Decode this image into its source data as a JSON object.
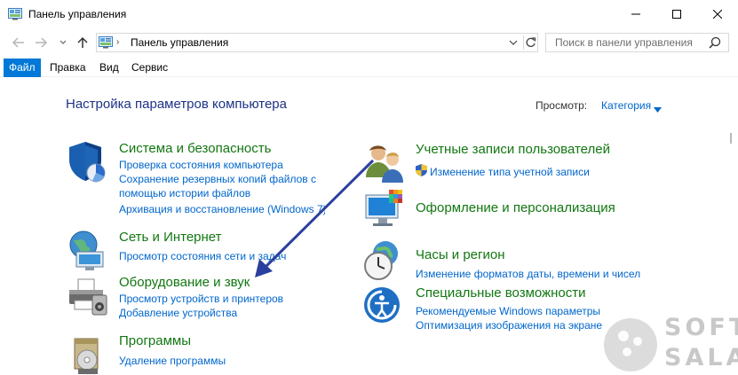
{
  "window": {
    "title": "Панель управления"
  },
  "address": {
    "path": "Панель управления",
    "separator": "›"
  },
  "search": {
    "placeholder": "Поиск в панели управления"
  },
  "menu": [
    {
      "label": "Файл",
      "active": true
    },
    {
      "label": "Правка",
      "active": false
    },
    {
      "label": "Вид",
      "active": false
    },
    {
      "label": "Сервис",
      "active": false
    }
  ],
  "main": {
    "title": "Настройка параметров компьютера",
    "view_by_label": "Просмотр:",
    "view_by_value": "Категория"
  },
  "categories_left": [
    {
      "title": "Система и безопасность",
      "icon": "shield-icon",
      "links": [
        "Проверка состояния компьютера",
        "Сохранение резервных копий файлов с",
        "помощью истории файлов",
        "Архивация и восстановление (Windows 7)"
      ]
    },
    {
      "title": "Сеть и Интернет",
      "icon": "network-icon",
      "links": [
        "Просмотр состояния сети и задач"
      ]
    },
    {
      "title": "Оборудование и звук",
      "icon": "printer-icon",
      "links": [
        "Просмотр устройств и принтеров",
        "Добавление устройства"
      ]
    },
    {
      "title": "Программы",
      "icon": "programs-icon",
      "links": [
        "Удаление программы"
      ]
    }
  ],
  "categories_right": [
    {
      "title": "Учетные записи пользователей",
      "icon": "users-icon",
      "links": [
        "Изменение типа учетной записи"
      ]
    },
    {
      "title": "Оформление и персонализация",
      "icon": "monitor-icon",
      "links": []
    },
    {
      "title": "Часы и регион",
      "icon": "clock-globe-icon",
      "links": [
        "Изменение форматов даты, времени и чисел"
      ]
    },
    {
      "title": "Специальные возможности",
      "icon": "accessibility-icon",
      "links": [
        "Рекомендуемые Windows параметры",
        "Оптимизация изображения на экране"
      ]
    }
  ],
  "watermark": {
    "line1": "SOFT",
    "line2": "SALAD"
  },
  "colors": {
    "accent": "#0078d7",
    "link": "#0066cc",
    "category_title": "#117711",
    "page_title": "#1e3287",
    "annotation_arrow": "#2b3f9e"
  }
}
